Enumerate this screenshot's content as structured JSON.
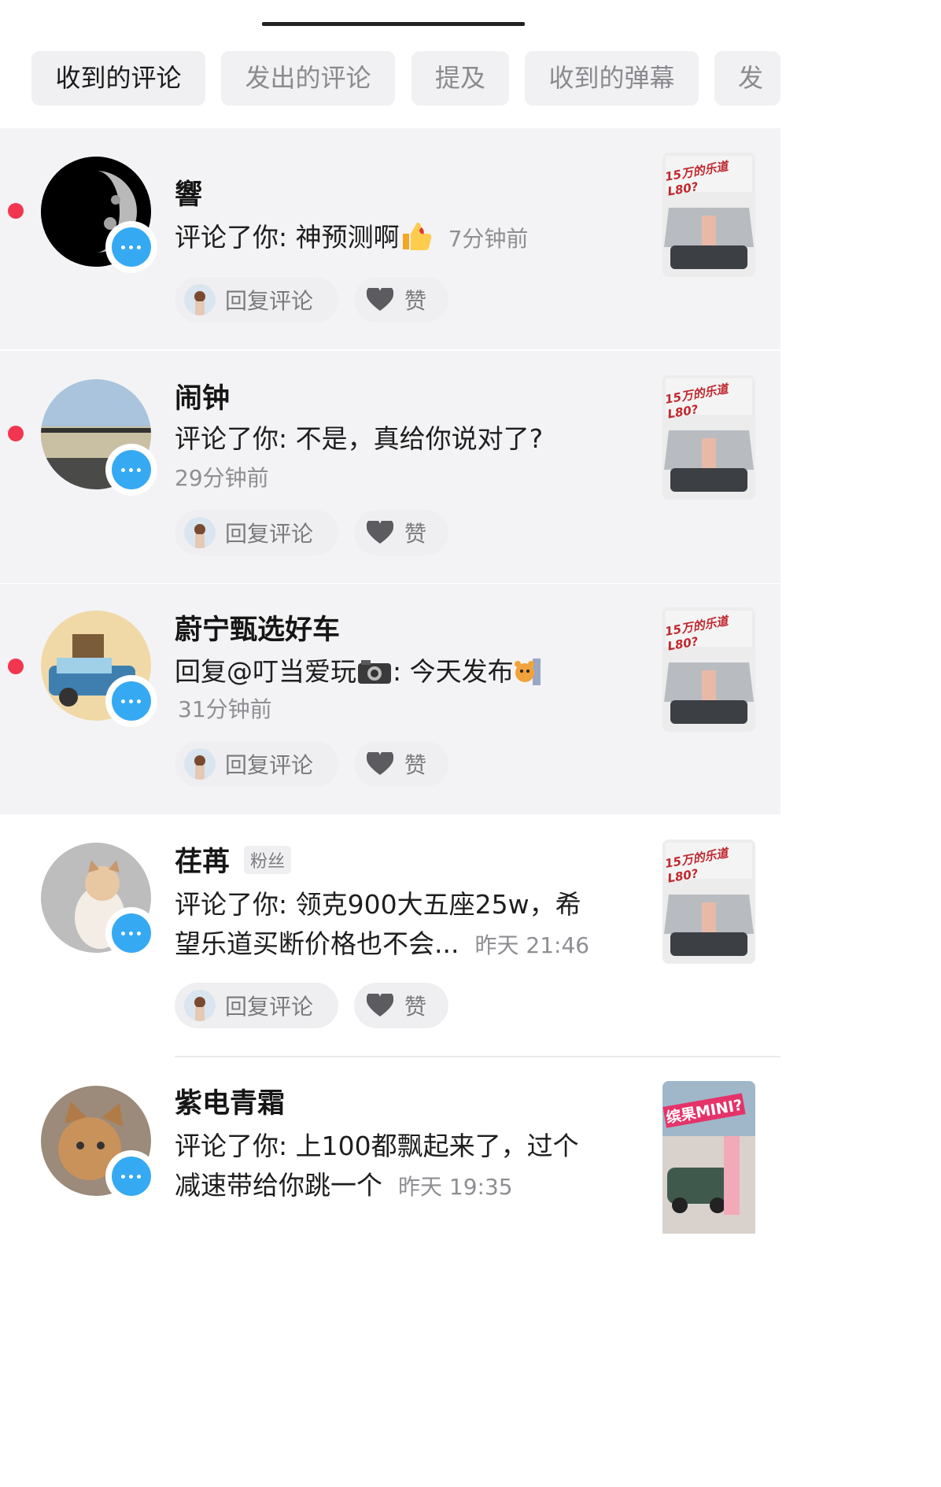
{
  "filter_tabs": [
    {
      "label": "收到的评论",
      "active": true
    },
    {
      "label": "发出的评论",
      "active": false
    },
    {
      "label": "提及",
      "active": false
    },
    {
      "label": "收到的弹幕",
      "active": false
    },
    {
      "label": "发",
      "active": false
    }
  ],
  "actions": {
    "reply_label": "回复评论",
    "like_label": "赞"
  },
  "comments": [
    {
      "name": "響",
      "prefix": "评论了你: ",
      "content": "神预测啊",
      "time": "7分钟前",
      "thumb_text": "15万的乐道L80?",
      "unread": true
    },
    {
      "name": "闹钟",
      "prefix": "评论了你: ",
      "content": "不是，真给你说对了?",
      "time": "29分钟前",
      "thumb_text": "15万的乐道L80?",
      "unread": true
    },
    {
      "name": "蔚宁甄选好车",
      "prefix": "回复@叮当爱玩",
      "content": ": 今天发布",
      "time": "31分钟前",
      "thumb_text": "15万的乐道L80?",
      "unread": true
    },
    {
      "name": "荏苒",
      "tag": "粉丝",
      "prefix": "评论了你: ",
      "content": "领克900大五座25w，希",
      "content2": "望乐道买断价格也不会...",
      "time": "昨天 21:46",
      "thumb_text": "15万的乐道L80?",
      "unread": false
    },
    {
      "name": "紫电青霜",
      "prefix": "评论了你: ",
      "content": "上100都飘起来了，过个",
      "content2": "减速带给你跳一个",
      "time": "昨天 19:35",
      "thumb_text": "缤果MINI?",
      "unread": false
    }
  ],
  "colors": {
    "unread_dot": "#f23650",
    "badge": "#36a9f3"
  }
}
